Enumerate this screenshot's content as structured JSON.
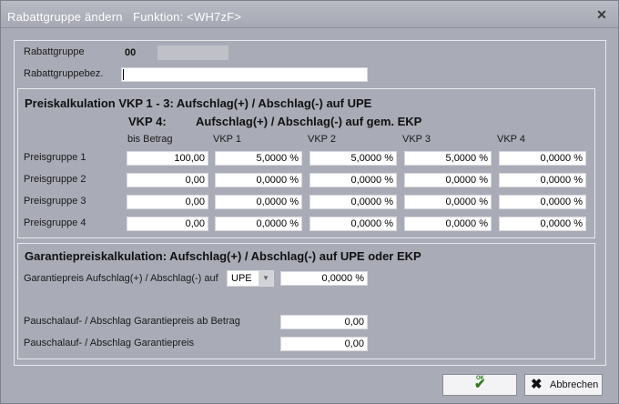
{
  "window": {
    "title": "Rabattgruppe ändern",
    "function_label": "Funktion:",
    "function_code": "<WH7zF>"
  },
  "header_fields": {
    "rabattgruppe_label": "Rabattgruppe",
    "rabattgruppe_value": "00",
    "bezeichnung_label": "Rabattgruppebez.",
    "bezeichnung_value": ""
  },
  "preiskalkulation": {
    "heading_line1": "Preiskalkulation VKP 1 - 3:  Aufschlag(+) / Abschlag(-) auf UPE",
    "heading_line2_prefix": "VKP 4:",
    "heading_line2_text": "Aufschlag(+) / Abschlag(-) auf gem. EKP",
    "columns": [
      "bis Betrag",
      "VKP 1",
      "VKP 2",
      "VKP 3",
      "VKP 4"
    ],
    "rows": [
      {
        "label": "Preisgruppe 1",
        "values": [
          "100,00",
          "5,0000 %",
          "5,0000 %",
          "5,0000 %",
          "0,0000 %"
        ]
      },
      {
        "label": "Preisgruppe 2",
        "values": [
          "0,00",
          "0,0000 %",
          "0,0000 %",
          "0,0000 %",
          "0,0000 %"
        ]
      },
      {
        "label": "Preisgruppe 3",
        "values": [
          "0,00",
          "0,0000 %",
          "0,0000 %",
          "0,0000 %",
          "0,0000 %"
        ]
      },
      {
        "label": "Preisgruppe 4",
        "values": [
          "0,00",
          "0,0000 %",
          "0,0000 %",
          "0,0000 %",
          "0,0000 %"
        ]
      }
    ]
  },
  "garantie": {
    "heading": "Garantiepreiskalkulation:  Aufschlag(+) / Abschlag(-) auf UPE oder EKP",
    "aufschlag_label": "Garantiepreis Aufschlag(+) / Abschlag(-) auf",
    "basis_selected": "UPE",
    "aufschlag_value": "0,0000 %",
    "pauschal_ab_label": "Pauschalauf- / Abschlag Garantiepreis ab Betrag",
    "pauschal_ab_value": "0,00",
    "pauschal_label": "Pauschalauf- / Abschlag Garantiepreis",
    "pauschal_value": "0,00"
  },
  "buttons": {
    "ok_label": "OK",
    "cancel_label": "Abbrechen"
  },
  "icons": {
    "close": "close-icon",
    "ok": "checkmark-icon",
    "cancel": "x-icon",
    "combo": "chevron-down-icon"
  },
  "colors": {
    "window_bg": "#a9abb6",
    "field_bg": "#ffffff",
    "ok_check": "#2f7d1e"
  }
}
